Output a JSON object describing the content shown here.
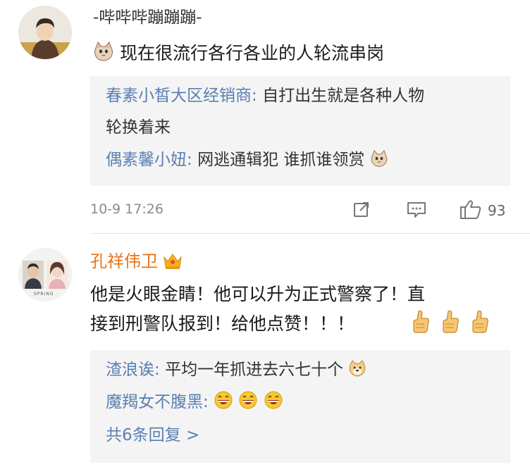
{
  "colors": {
    "reply_author": "#5a7fb3",
    "accent_orange": "#e8741a",
    "meta_gray": "#8a8a8a",
    "reply_bg": "#f4f4f4"
  },
  "comment1": {
    "username": "-哔哔哔蹦蹦蹦-",
    "avatar_icon": "boy-avatar-photo",
    "emoji_icon": "cat-face-icon",
    "text": "现在很流行各行各业的人轮流串岗",
    "replies": [
      {
        "author": "春素小皙大区经销商",
        "sep": ":",
        "text_line1": "自打出生就是各种人物",
        "text_line2": "轮换着来"
      },
      {
        "author": "偶素馨小妞",
        "sep": ":",
        "text": "网逃通辑犯 谁抓谁领赏",
        "emoji_icon": "cat-face-icon"
      }
    ],
    "timestamp": "10-9 17:26",
    "share_icon": "share-icon",
    "comment_icon": "comment-icon",
    "like_icon": "thumbs-up-icon",
    "like_count": "93"
  },
  "comment2": {
    "username": "孔祥伟卫",
    "avatar_icon": "couple-avatar-photo",
    "avatar_caption": "SPRING",
    "badge_icon": "crown-badge-icon",
    "text_line1": "他是火眼金睛！他可以升为正式警察了！直",
    "text_line2": "接到刑警队报到！给他点赞！！！",
    "thumbs_icons": [
      "thumbs-up-emoji-icon",
      "thumbs-up-emoji-icon",
      "thumbs-up-emoji-icon"
    ],
    "replies": [
      {
        "author": "渣浪诶",
        "sep": ":",
        "text": "平均一年抓进去六七十个",
        "emoji_icon": "doge-icon"
      },
      {
        "author": "魔羯女不腹黑",
        "sep": ":",
        "text": "",
        "emoji_icons": [
          "grin-laugh-icon",
          "grin-laugh-icon",
          "grin-laugh-icon"
        ]
      }
    ],
    "more_replies": "共6条回复 >"
  }
}
